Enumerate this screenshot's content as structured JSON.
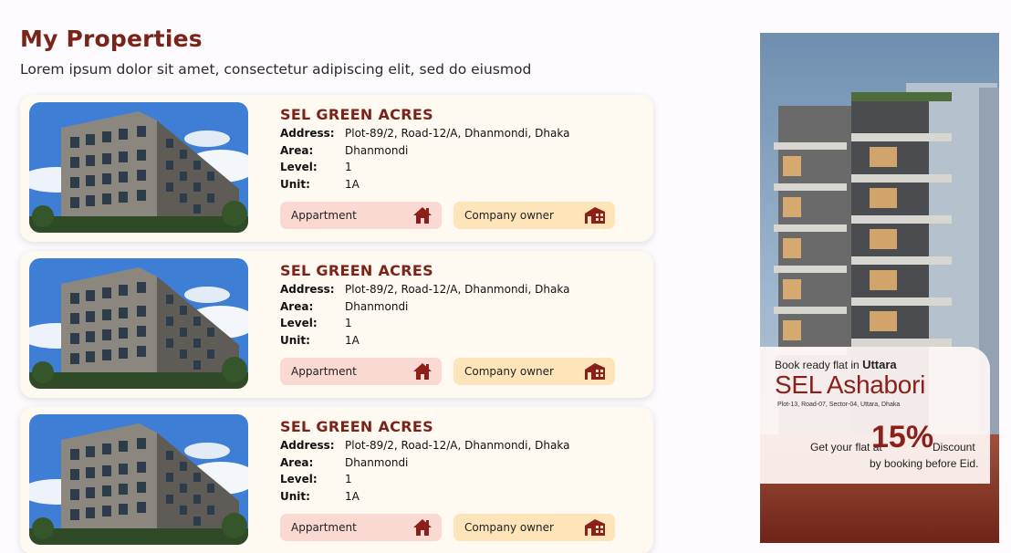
{
  "header": {
    "title": "My Properties",
    "subtitle": "Lorem ipsum dolor sit amet, consectetur adipiscing elit, sed do eiusmod"
  },
  "labels": {
    "address": "Address:",
    "area": "Area:",
    "level": "Level:",
    "unit": "Unit:"
  },
  "properties": [
    {
      "name": "SEL GREEN ACRES",
      "address": "Plot-89/2, Road-12/A, Dhanmondi, Dhaka",
      "area": "Dhanmondi",
      "level": "1",
      "unit": "1A",
      "type_tag": "Appartment",
      "owner_tag": "Company owner"
    },
    {
      "name": "SEL GREEN ACRES",
      "address": "Plot-89/2, Road-12/A, Dhanmondi, Dhaka",
      "area": "Dhanmondi",
      "level": "1",
      "unit": "1A",
      "type_tag": "Appartment",
      "owner_tag": "Company owner"
    },
    {
      "name": "SEL GREEN ACRES",
      "address": "Plot-89/2, Road-12/A, Dhanmondi, Dhaka",
      "area": "Dhanmondi",
      "level": "1",
      "unit": "1A",
      "type_tag": "Appartment",
      "owner_tag": "Company owner"
    }
  ],
  "icons": {
    "type_tag": "house-icon",
    "owner_tag": "building-icon"
  },
  "ad": {
    "line1_prefix": "Book ready flat in",
    "line1_location": "Uttara",
    "title": "SEL Ashabori",
    "address": "Plot-13, Road-07, Sector-04, Uttara, Dhaka",
    "offer_prefix": "Get your flat at",
    "offer_percent": "15%",
    "offer_suffix": "Discount",
    "offer_note": "by booking before Eid."
  },
  "colors": {
    "accent": "#7a2318",
    "card_bg": "#fffaf1",
    "type_tag_bg": "#fbd9d3",
    "owner_tag_bg": "#fde4b9",
    "ad_accent": "#8b1f1a"
  }
}
